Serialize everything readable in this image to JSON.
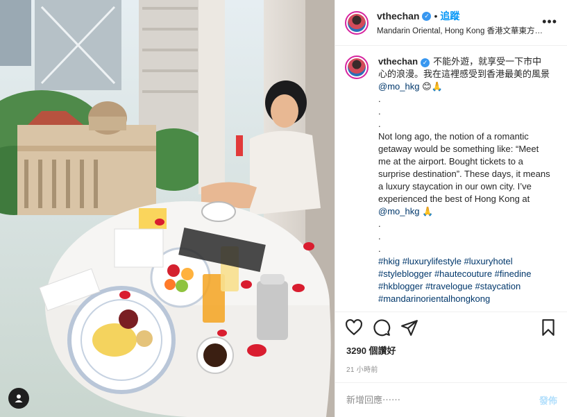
{
  "post": {
    "username": "vthechan",
    "verified": true,
    "follow_separator": "•",
    "follow_label": "追蹤",
    "location": "Mandarin Oriental, Hong Kong 香港文華東方…",
    "more_label": "•••"
  },
  "caption": {
    "username": "vthechan",
    "lines": [
      "不能外遊，就享受一下市中心的浪漫。我在這裡感受到香港最美的風景 ",
      "@mo_hkg",
      " 😊🙏\n.\n.\n.\nNot long ago, the notion of a romantic getaway would be something like: “Meet me at the airport. Bought tickets to a surprise destination”. These days, it means a luxury staycation in our own city. I’ve experienced the best of Hong Kong at ",
      "@mo_hkg",
      " 🙏\n.\n.\n.\n",
      "#hkig #luxurylifestyle #luxuryhotel #styleblogger #hautecouture #finedine #hkblogger #travelogue #staycation #mandarinorientalhongkong"
    ]
  },
  "stats": {
    "likes": "3290 個讚好",
    "time": "21 小時前"
  },
  "comment": {
    "placeholder": "新增回應⋯⋯",
    "post_label": "發佈"
  },
  "icons": {
    "like": "heart-icon",
    "comment": "comment-icon",
    "share": "share-icon",
    "save": "bookmark-icon",
    "tags": "user-tag-icon"
  },
  "colors": {
    "accent": "#0095f6",
    "verified": "#3897f0",
    "link": "#00376b",
    "muted": "#8e8e8e"
  }
}
